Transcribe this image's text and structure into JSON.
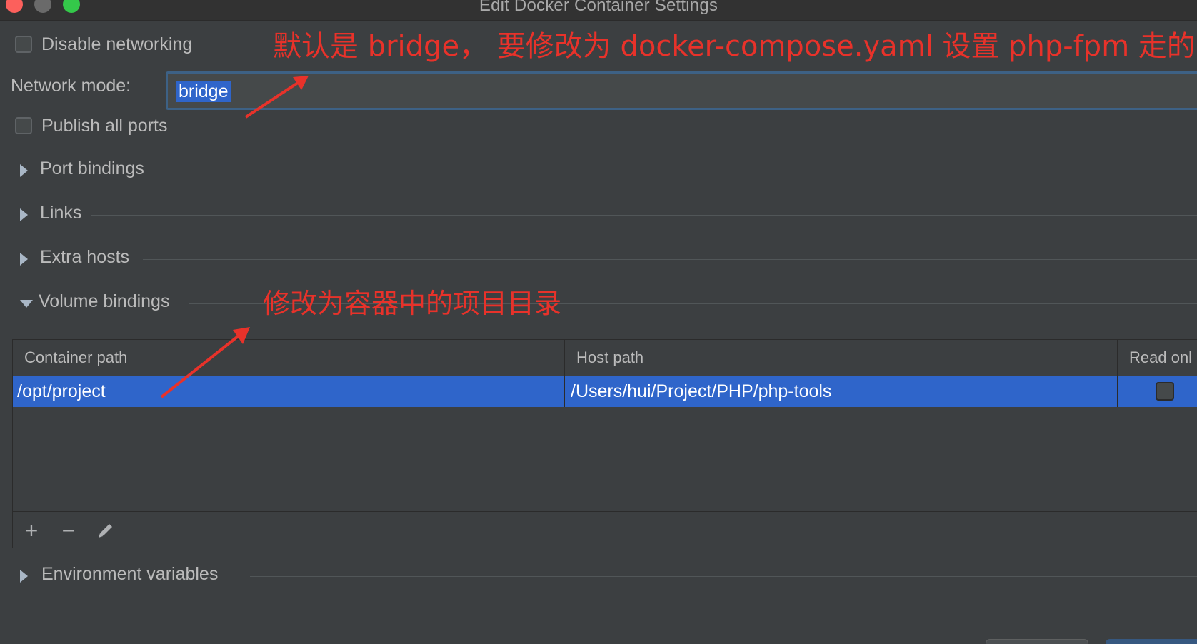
{
  "window": {
    "title": "Edit Docker Container Settings"
  },
  "options": {
    "disable_networking_label": "Disable networking",
    "disable_networking_checked": false,
    "network_mode_label": "Network mode:",
    "network_mode_value": "bridge",
    "publish_all_ports_label": "Publish all ports",
    "publish_all_ports_checked": false
  },
  "sections": {
    "port_bindings": "Port bindings",
    "links": "Links",
    "extra_hosts": "Extra hosts",
    "volume_bindings": "Volume bindings",
    "environment_variables": "Environment variables"
  },
  "volume_table": {
    "columns": [
      "Container path",
      "Host path",
      "Read onl"
    ],
    "rows": [
      {
        "container_path": "/opt/project",
        "host_path": "/Users/hui/Project/PHP/php-tools",
        "read_only": false
      }
    ],
    "toolbar": {
      "add": "+",
      "remove": "−",
      "edit": "✎"
    }
  },
  "annotations": {
    "network_note": "默认是 bridge， 要修改为 docker-compose.yaml 设置 php-fpm 走的网络",
    "volume_note": "修改为容器中的项目目录"
  },
  "colors": {
    "background": "#3c3f41",
    "selection": "#2f65ca",
    "annotation": "#e8322a",
    "close": "#fc605c",
    "maximize": "#34c84a"
  }
}
